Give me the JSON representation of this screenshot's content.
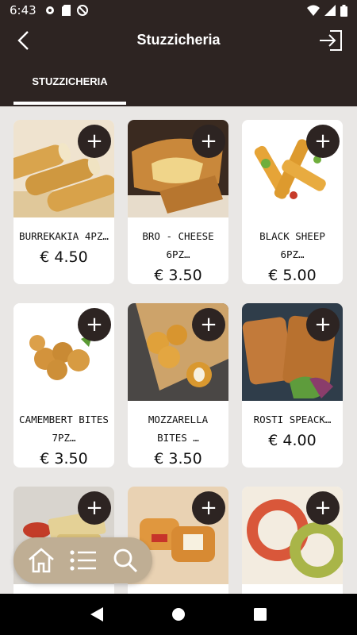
{
  "status_bar": {
    "time": "6:43"
  },
  "app_bar": {
    "title": "Stuzzicheria",
    "back_icon": "arrow-left-icon",
    "logout_icon": "logout-icon",
    "tab_label": "STUZZICHERIA"
  },
  "products": [
    {
      "name": "BURREKAKIA 4PZ…",
      "price": "€ 4.50",
      "image": "spring-rolls-photo"
    },
    {
      "name": "BRO - CHEESE 6PZ…",
      "price": "€ 3.50",
      "image": "cheese-rolls-photo"
    },
    {
      "name": "BLACK SHEEP 6PZ…",
      "price": "€ 5.00",
      "image": "cheese-sticks-photo"
    },
    {
      "name": "CAMEMBERT BITES\n7PZ…",
      "price": "€ 3.50",
      "image": "camembert-bites-photo"
    },
    {
      "name": "MOZZARELLA\nBITES …",
      "price": "€ 3.50",
      "image": "mozzarella-bites-photo"
    },
    {
      "name": "ROSTI SPEACK…",
      "price": "€ 4.00",
      "image": "rosti-photo"
    },
    {
      "name": "",
      "price": "",
      "image": "fries-with-sauce-photo"
    },
    {
      "name": "",
      "price": "",
      "image": "breaded-cheese-photo"
    },
    {
      "name": "",
      "price": "",
      "image": "onion-rings-photo"
    }
  ],
  "add_button_label": "+",
  "colors": {
    "primary": "#2d2422",
    "background": "#e9e7e5",
    "nav_pill": "#bfae94"
  }
}
